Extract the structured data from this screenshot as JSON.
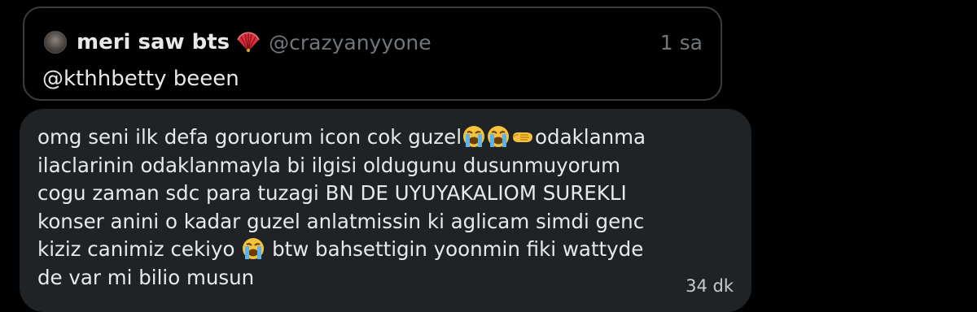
{
  "quoted_tweet": {
    "display_name": "meri saw bts",
    "display_name_icon": "folding-hand-fan-icon",
    "handle": "@crazyanyyone",
    "timestamp": "1 sa",
    "text": "@kthhbetty beeen"
  },
  "message": {
    "lines": {
      "l1_a": "omg seni ilk defa goruorum icon cok guzel",
      "l1_b": "odaklanma",
      "l2": "ilaclarinin odaklanmayla bi ilgisi oldugunu dusunmuyorum",
      "l3": "cogu zaman sdc para tuzagi BN DE UYUYAKALIOM SUREKLI",
      "l4": "konser anini o kadar guzel anlatmissin ki aglicam simdi genc",
      "l5_a": "kiziz canimiz cekiyo",
      "l5_b": " btw bahsettigin yoonmin fiki wattyde",
      "l6": "de var mi bilio musun"
    },
    "emojis": [
      "loudly-crying-face-icon",
      "loudly-crying-face-icon",
      "leftwards-pushing-hand-icon",
      "loudly-crying-face-icon"
    ],
    "time": "34 dk"
  },
  "colors": {
    "background": "#000000",
    "bubble": "#202326",
    "text": "#e7e9ea",
    "muted": "#71767b",
    "border": "#3a3d41"
  }
}
